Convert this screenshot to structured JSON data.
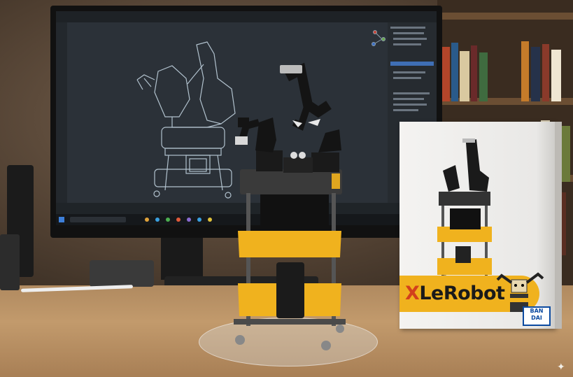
{
  "box": {
    "logo_prefix": "X",
    "logo_rest": "LeRobot",
    "brand_line1": "BAN",
    "brand_line2": "DAI"
  },
  "colors": {
    "accent_yellow": "#f0b21e",
    "logo_x": "#d2401c",
    "cart_gray": "#3a3a3a",
    "brand_blue": "#0b4aa0"
  },
  "icons": {
    "corner": "sparkle-icon"
  }
}
